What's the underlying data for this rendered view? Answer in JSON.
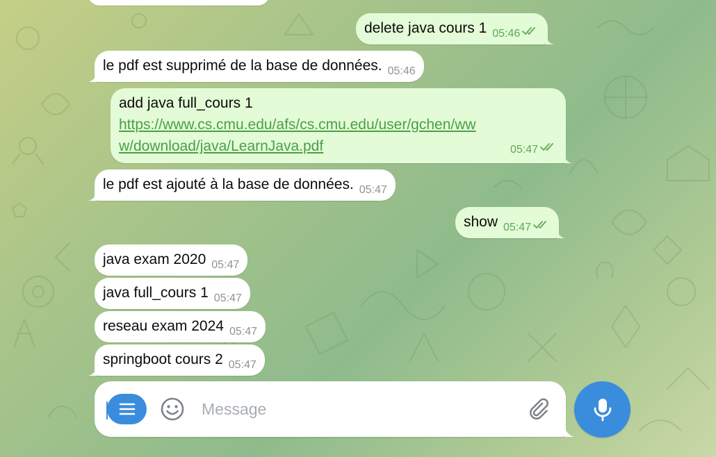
{
  "messages": {
    "m1": {
      "text": "delete java cours 1",
      "time": "05:46",
      "direction": "outgoing",
      "status": "read"
    },
    "m2": {
      "text": "le pdf est supprimé de la base de données.",
      "time": "05:46",
      "direction": "incoming"
    },
    "m3": {
      "line1": "add java full_cours 1",
      "link_line1": "https://www.cs.cmu.edu/afs/cs.cmu.edu/user/gchen/ww",
      "link_line2": "w/download/java/LearnJava.pdf",
      "time": "05:47",
      "direction": "outgoing",
      "status": "read"
    },
    "m4": {
      "text": "le pdf est ajouté à la base de données.",
      "time": "05:47",
      "direction": "incoming"
    },
    "m5": {
      "text": "show",
      "time": "05:47",
      "direction": "outgoing",
      "status": "read"
    },
    "m6": {
      "text": "java exam 2020",
      "time": "05:47",
      "direction": "incoming"
    },
    "m7": {
      "text": "java full_cours 1",
      "time": "05:47",
      "direction": "incoming"
    },
    "m8": {
      "text": "reseau exam 2024",
      "time": "05:47",
      "direction": "incoming"
    },
    "m9": {
      "text": "springboot cours 2",
      "time": "05:47",
      "direction": "incoming"
    }
  },
  "composer": {
    "placeholder": "Message",
    "value": ""
  },
  "icons": {
    "menu": "menu-icon",
    "emoji": "smiley-icon",
    "attach": "paperclip-icon",
    "mic": "microphone-icon",
    "read": "double-check-icon"
  },
  "colors": {
    "accent": "#3a8ddd",
    "outgoing_bubble": "#e3fbd6",
    "incoming_bubble": "#ffffff",
    "outgoing_meta": "#5fa85a",
    "link": "#4a9f46"
  }
}
